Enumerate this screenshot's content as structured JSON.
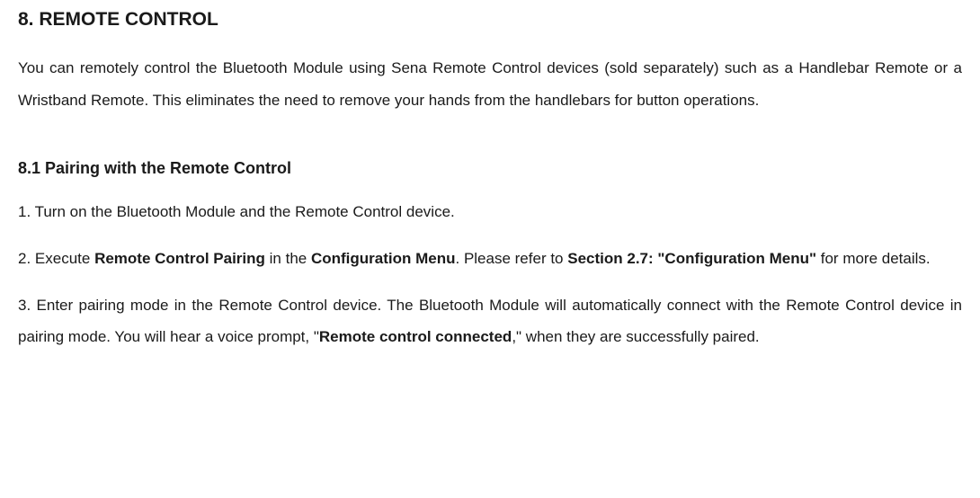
{
  "section": {
    "title": "8. REMOTE CONTROL",
    "intro": {
      "pre": "You can remotely control the Bluetooth Module using Sena Remote Control devices (sold separately) such as a Handlebar Remote or a Wristband Remote. This eliminates the need to remove your hands from the handlebars for button operations."
    },
    "sub": {
      "title": "8.1 Pairing with the Remote Control",
      "step1": "1. Turn on the Bluetooth Module and the Remote Control device.",
      "step2": {
        "p1": "2. Execute ",
        "b1": "Remote Control Pairing",
        "p2": " in the ",
        "b2": "Configuration Menu",
        "p3": ". Please refer to ",
        "b3": "Section 2.7: \"Configuration Menu\"",
        "p4": " for more details."
      },
      "step3": {
        "p1": "3. Enter pairing mode in the Remote Control device. The Bluetooth Module will automatically connect with the Remote Control device in pairing mode. You will hear a voice prompt, \"",
        "b1": "Remote control connected",
        "p2": ",\" when they are successfully paired."
      }
    }
  }
}
